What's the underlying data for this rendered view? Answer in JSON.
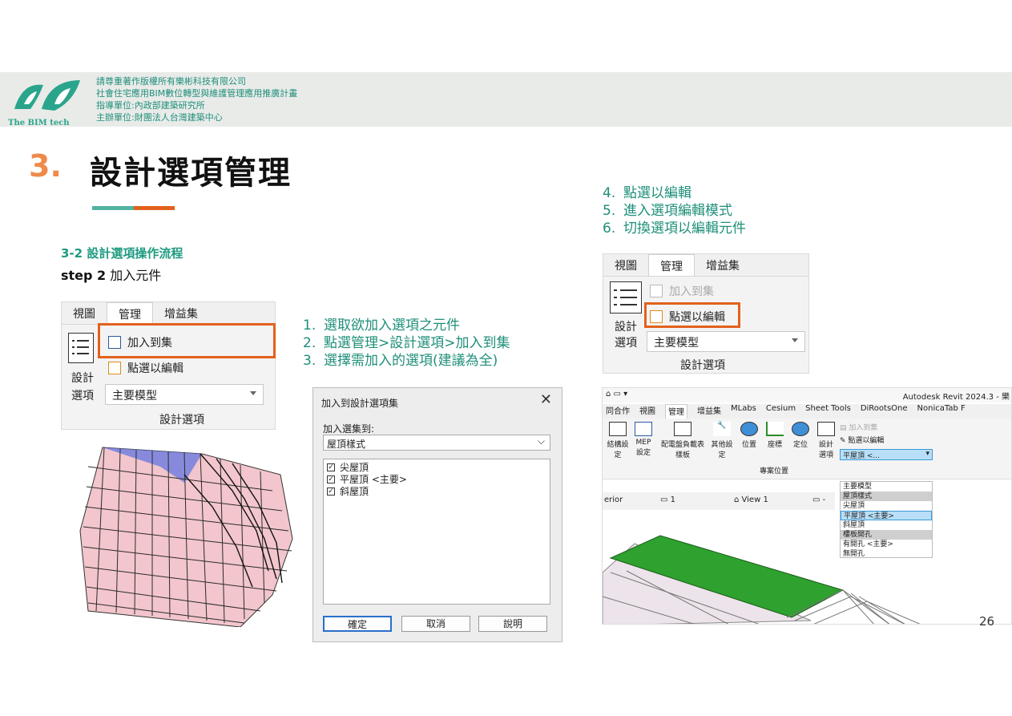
{
  "header": {
    "logo_text": "The BIM tech",
    "lines": [
      "請尊重著作版權所有樂彬科技有限公司",
      "社會住宅應用BIM數位轉型與維護管理應用推廣計畫",
      "指導單位:內政部建築研究所",
      "主辦單位:財團法人台灣建築中心"
    ]
  },
  "title": {
    "number": "3.",
    "text": "設計選項管理"
  },
  "section": {
    "subtitle": "3-2 設計選項操作流程",
    "step_bold": "step 2",
    "step_text": "加入元件"
  },
  "left_ribbon": {
    "tabs": [
      "視圖",
      "管理",
      "增益集"
    ],
    "add_to_set": "加入到集",
    "pick_to_edit": "點選以編輯",
    "big_label_1": "設計",
    "big_label_2": "選項",
    "combo_value": "主要模型",
    "panel_label": "設計選項"
  },
  "steps_middle": [
    {
      "n": "1.",
      "text": "選取欲加入選項之元件"
    },
    {
      "n": "2.",
      "text": "點選管理>設計選項>加入到集"
    },
    {
      "n": "3.",
      "text": "選擇需加入的選項(建議為全)"
    }
  ],
  "dialog": {
    "title": "加入到設計選項集",
    "close": "✕",
    "label": "加入選集到:",
    "selected": "屋頂樣式",
    "items": [
      {
        "label": "尖屋頂",
        "checked": true
      },
      {
        "label": "平屋頂 <主要>",
        "checked": true
      },
      {
        "label": "斜屋頂",
        "checked": true
      }
    ],
    "ok": "確定",
    "cancel": "取消",
    "help": "說明"
  },
  "steps_right": [
    {
      "n": "4.",
      "text": "點選以編輯"
    },
    {
      "n": "5.",
      "text": "進入選項編輯模式"
    },
    {
      "n": "6.",
      "text": "切換選項以編輯元件"
    }
  ],
  "right_ribbon": {
    "tabs": [
      "視圖",
      "管理",
      "增益集"
    ],
    "add_to_set": "加入到集",
    "pick_to_edit": "點選以編輯",
    "big_label_1": "設計",
    "big_label_2": "選項",
    "combo_value": "主要模型",
    "panel_label": "設計選項"
  },
  "revit": {
    "app_title": "Autodesk Revit 2024.3 - 樂",
    "tabs": [
      "同合作",
      "視圖",
      "管理",
      "增益集",
      "MLabs",
      "Cesium",
      "Sheet Tools",
      "DiRootsOne",
      "NonicaTab F"
    ],
    "tools": [
      "結構設定",
      "MEP 設定",
      "配電盤負載表樣板",
      "其他設定",
      "位置",
      "座標",
      "定位",
      "設計選項"
    ],
    "panel_caption": "專案位置",
    "add_to_set": "加入到集",
    "pick_to_edit": "點選以編輯",
    "combo_value": "平屋頂 <...",
    "view_tab": "View 1",
    "view_prefix": "erior",
    "view_num": "1",
    "dropdown": [
      {
        "label": "主要模型",
        "kind": "item"
      },
      {
        "label": "屋頂樣式",
        "kind": "group"
      },
      {
        "label": "尖屋頂",
        "kind": "item"
      },
      {
        "label": "平屋頂 <主要>",
        "kind": "sel"
      },
      {
        "label": "斜屋頂",
        "kind": "item"
      },
      {
        "label": "樓板開孔",
        "kind": "group"
      },
      {
        "label": "有開孔 <主要>",
        "kind": "item"
      },
      {
        "label": "無開孔",
        "kind": "item"
      }
    ]
  },
  "page_number": "26",
  "colors": {
    "teal": "#1f8f7a",
    "orange": "#e2611c",
    "title_num": "#ef8a4a"
  }
}
